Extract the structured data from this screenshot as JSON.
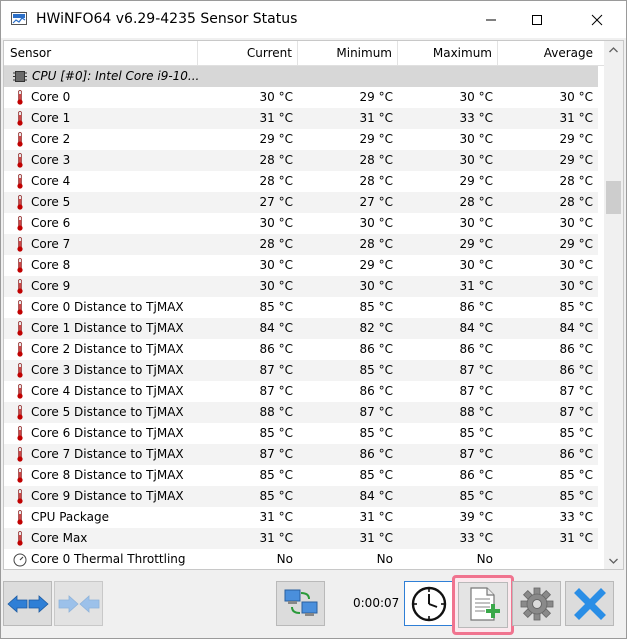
{
  "window": {
    "title": "HWiNFO64 v6.29-4235 Sensor Status"
  },
  "columns": {
    "sensor": "Sensor",
    "current": "Current",
    "minimum": "Minimum",
    "maximum": "Maximum",
    "average": "Average"
  },
  "group": {
    "label": "CPU [#0]: Intel Core i9-10...",
    "icon": "chip-icon"
  },
  "rows": [
    {
      "name": "Core 0",
      "current": "30 °C",
      "minimum": "29 °C",
      "maximum": "30 °C",
      "average": "30 °C",
      "icon": "thermometer-icon"
    },
    {
      "name": "Core 1",
      "current": "31 °C",
      "minimum": "31 °C",
      "maximum": "33 °C",
      "average": "31 °C",
      "icon": "thermometer-icon"
    },
    {
      "name": "Core 2",
      "current": "29 °C",
      "minimum": "29 °C",
      "maximum": "30 °C",
      "average": "29 °C",
      "icon": "thermometer-icon"
    },
    {
      "name": "Core 3",
      "current": "28 °C",
      "minimum": "28 °C",
      "maximum": "30 °C",
      "average": "29 °C",
      "icon": "thermometer-icon"
    },
    {
      "name": "Core 4",
      "current": "28 °C",
      "minimum": "28 °C",
      "maximum": "29 °C",
      "average": "28 °C",
      "icon": "thermometer-icon"
    },
    {
      "name": "Core 5",
      "current": "27 °C",
      "minimum": "27 °C",
      "maximum": "28 °C",
      "average": "28 °C",
      "icon": "thermometer-icon"
    },
    {
      "name": "Core 6",
      "current": "30 °C",
      "minimum": "30 °C",
      "maximum": "30 °C",
      "average": "30 °C",
      "icon": "thermometer-icon"
    },
    {
      "name": "Core 7",
      "current": "28 °C",
      "minimum": "28 °C",
      "maximum": "29 °C",
      "average": "29 °C",
      "icon": "thermometer-icon"
    },
    {
      "name": "Core 8",
      "current": "30 °C",
      "minimum": "29 °C",
      "maximum": "30 °C",
      "average": "30 °C",
      "icon": "thermometer-icon"
    },
    {
      "name": "Core 9",
      "current": "30 °C",
      "minimum": "30 °C",
      "maximum": "31 °C",
      "average": "30 °C",
      "icon": "thermometer-icon"
    },
    {
      "name": "Core 0 Distance to TjMAX",
      "current": "85 °C",
      "minimum": "85 °C",
      "maximum": "86 °C",
      "average": "85 °C",
      "icon": "thermometer-icon"
    },
    {
      "name": "Core 1 Distance to TjMAX",
      "current": "84 °C",
      "minimum": "82 °C",
      "maximum": "84 °C",
      "average": "84 °C",
      "icon": "thermometer-icon"
    },
    {
      "name": "Core 2 Distance to TjMAX",
      "current": "86 °C",
      "minimum": "86 °C",
      "maximum": "86 °C",
      "average": "86 °C",
      "icon": "thermometer-icon"
    },
    {
      "name": "Core 3 Distance to TjMAX",
      "current": "87 °C",
      "minimum": "85 °C",
      "maximum": "87 °C",
      "average": "86 °C",
      "icon": "thermometer-icon"
    },
    {
      "name": "Core 4 Distance to TjMAX",
      "current": "87 °C",
      "minimum": "86 °C",
      "maximum": "87 °C",
      "average": "87 °C",
      "icon": "thermometer-icon"
    },
    {
      "name": "Core 5 Distance to TjMAX",
      "current": "88 °C",
      "minimum": "87 °C",
      "maximum": "88 °C",
      "average": "87 °C",
      "icon": "thermometer-icon"
    },
    {
      "name": "Core 6 Distance to TjMAX",
      "current": "85 °C",
      "minimum": "85 °C",
      "maximum": "85 °C",
      "average": "85 °C",
      "icon": "thermometer-icon"
    },
    {
      "name": "Core 7 Distance to TjMAX",
      "current": "87 °C",
      "minimum": "86 °C",
      "maximum": "87 °C",
      "average": "86 °C",
      "icon": "thermometer-icon"
    },
    {
      "name": "Core 8 Distance to TjMAX",
      "current": "85 °C",
      "minimum": "85 °C",
      "maximum": "86 °C",
      "average": "85 °C",
      "icon": "thermometer-icon"
    },
    {
      "name": "Core 9 Distance to TjMAX",
      "current": "85 °C",
      "minimum": "84 °C",
      "maximum": "85 °C",
      "average": "85 °C",
      "icon": "thermometer-icon"
    },
    {
      "name": "CPU Package",
      "current": "31 °C",
      "minimum": "31 °C",
      "maximum": "39 °C",
      "average": "33 °C",
      "icon": "thermometer-icon"
    },
    {
      "name": "Core Max",
      "current": "31 °C",
      "minimum": "31 °C",
      "maximum": "33 °C",
      "average": "31 °C",
      "icon": "thermometer-icon"
    },
    {
      "name": "Core 0 Thermal Throttling",
      "current": "No",
      "minimum": "No",
      "maximum": "No",
      "average": "",
      "icon": "gauge-icon"
    }
  ],
  "toolbar": {
    "elapsed": "0:00:07",
    "buttons": [
      {
        "icon": "expand-arrows-icon",
        "enabled": true
      },
      {
        "icon": "collapse-arrows-icon",
        "enabled": false
      },
      {
        "icon": "network-icon",
        "enabled": true
      },
      {
        "icon": "clock-icon",
        "enabled": true
      },
      {
        "icon": "log-file-add-icon",
        "enabled": true,
        "highlighted": true
      },
      {
        "icon": "gear-icon",
        "enabled": true
      },
      {
        "icon": "close-x-icon",
        "enabled": true
      }
    ]
  },
  "colors": {
    "highlight": "#f0748f",
    "group_row": "#d7d7d7",
    "thermometer": "#c00000",
    "close_x": "#2a8ee6"
  }
}
